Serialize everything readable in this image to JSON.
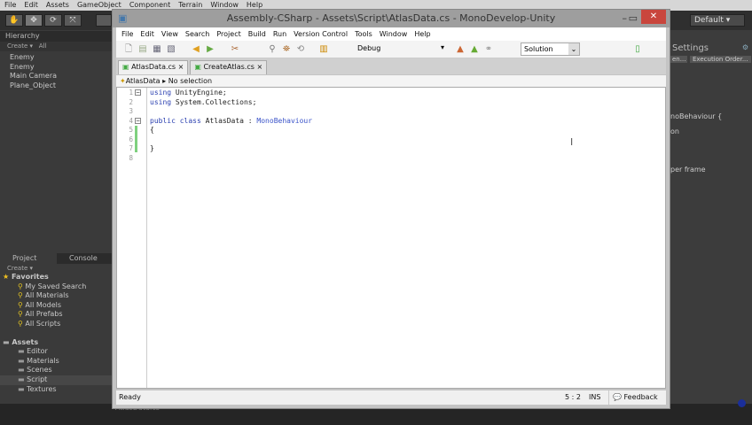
{
  "unity": {
    "menu": [
      "File",
      "Edit",
      "Assets",
      "GameObject",
      "Component",
      "Terrain",
      "Window",
      "Help"
    ],
    "layout": "Default",
    "hierarchy": {
      "title": "Hierarchy",
      "create": "Create",
      "search": "All",
      "items": [
        "Enemy",
        "Enemy",
        "Main Camera",
        "Plane_Object"
      ]
    },
    "project": {
      "tabs": [
        "Project",
        "Console"
      ],
      "create": "Create",
      "favorites_label": "Favorites",
      "favorites": [
        "My Saved Search",
        "All Materials",
        "All Models",
        "All Prefabs",
        "All Scripts"
      ],
      "assets_label": "Assets",
      "folders": [
        "Editor",
        "Materials",
        "Scenes",
        "Script",
        "Textures"
      ],
      "selected_folder": "Script"
    },
    "inspector": {
      "title": "Settings",
      "button1": "en...",
      "button2": "Execution Order...",
      "lines": [
        "noBehaviour {",
        "on",
        "per frame"
      ]
    },
    "bottom_file": "AtlasData.cs"
  },
  "monodevelop": {
    "title": "Assembly-CSharp - Assets\\Script\\AtlasData.cs - MonoDevelop-Unity",
    "menu": [
      "File",
      "Edit",
      "View",
      "Search",
      "Project",
      "Build",
      "Run",
      "Version Control",
      "Tools",
      "Window",
      "Help"
    ],
    "config": "Debug",
    "solution": "Solution",
    "tabs": [
      "AtlasData.cs",
      "CreateAtlas.cs"
    ],
    "breadcrumb": {
      "class": "AtlasData",
      "selection": "No selection"
    },
    "code": [
      "using UnityEngine;",
      "using System.Collections;",
      "",
      "public class AtlasData : MonoBehaviour",
      "{",
      "",
      "}",
      ""
    ],
    "status": {
      "text": "Ready",
      "position": "5 : 2",
      "mode": "INS",
      "feedback": "Feedback"
    }
  }
}
